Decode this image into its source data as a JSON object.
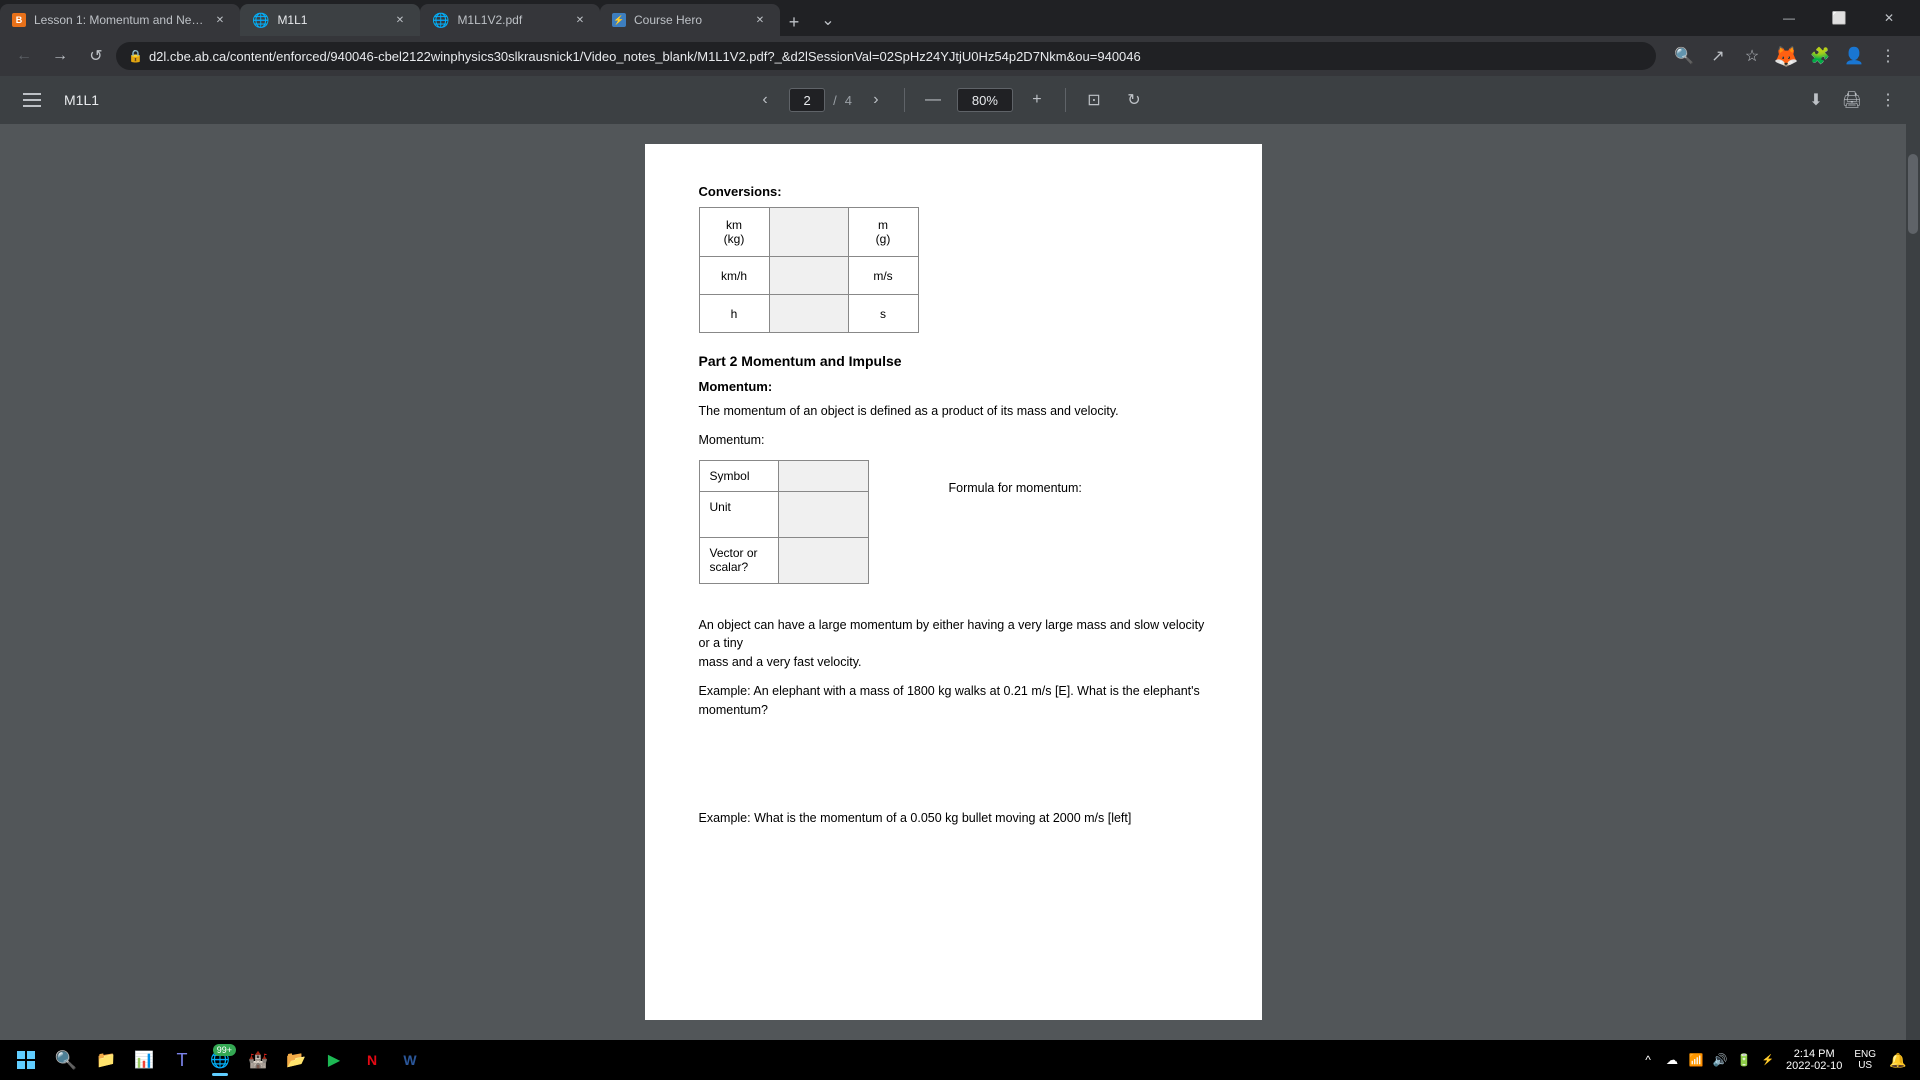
{
  "tabs": [
    {
      "id": "tab1",
      "title": "Lesson 1: Momentum and Newt...",
      "favicon": "B",
      "favicon_color": "#e8711a",
      "active": false
    },
    {
      "id": "tab2",
      "title": "M1L1",
      "favicon": "globe",
      "active": true
    },
    {
      "id": "tab3",
      "title": "M1L1V2.pdf",
      "favicon": "globe",
      "active": false
    },
    {
      "id": "tab4",
      "title": "Course Hero",
      "favicon": "CH",
      "active": false
    }
  ],
  "url": "d2l.cbe.ab.ca/content/enforced/940046-cbel2122winphysics30slkrausnick1/Video_notes_blank/M1L1V2.pdf?_&d2lSessionVal=02SpHz24YJtjU0Hz54p2D7Nkm&ou=940046",
  "pdf_viewer": {
    "title": "M1L1",
    "current_page": "2",
    "total_pages": "4",
    "zoom": "80%"
  },
  "document": {
    "conversions_title": "Conversions:",
    "table1": {
      "rows": [
        [
          "km\n(kg)",
          "",
          "m\n(g)"
        ],
        [
          "km/h",
          "",
          "m/s"
        ],
        [
          "h",
          "",
          "s"
        ]
      ]
    },
    "part2_title": "Part 2 Momentum and Impulse",
    "momentum_section": {
      "label": "Momentum:",
      "description": "The momentum of an object is defined as a product of its mass and velocity.",
      "momentum_label2": "Momentum:",
      "table_rows": [
        {
          "label": "Symbol",
          "value": ""
        },
        {
          "label": "Unit",
          "value": ""
        },
        {
          "label": "Vector or\nscalar?",
          "value": ""
        }
      ],
      "formula_label": "Formula for momentum:",
      "large_momentum_text": "An object can have a large momentum by either having a very large mass and slow velocity or a tiny\nmass and a very fast velocity.",
      "example1": "Example: An elephant with a mass of 1800 kg walks at 0.21 m/s [E]. What is the elephant's\nmomentum?",
      "example2": "Example: What is the momentum of a 0.050 kg bullet moving at 2000 m/s [left]"
    }
  },
  "taskbar": {
    "time": "2:14 PM",
    "date": "2022-02-10",
    "language": "ENG\nUS",
    "apps": [
      {
        "name": "File Explorer",
        "icon": "📁",
        "active": false
      },
      {
        "name": "Task Manager",
        "icon": "📊",
        "active": false
      },
      {
        "name": "Microsoft Teams",
        "icon": "🟦",
        "active": false
      },
      {
        "name": "Chrome",
        "icon": "🌐",
        "active": true,
        "badge": "99+"
      },
      {
        "name": "Disney",
        "icon": "🏰",
        "active": false
      },
      {
        "name": "File Manager",
        "icon": "📂",
        "active": false
      },
      {
        "name": "Spotify",
        "icon": "🎵",
        "active": false
      },
      {
        "name": "Netflix",
        "icon": "🎬",
        "active": false
      },
      {
        "name": "Word",
        "icon": "📝",
        "active": false
      }
    ]
  }
}
